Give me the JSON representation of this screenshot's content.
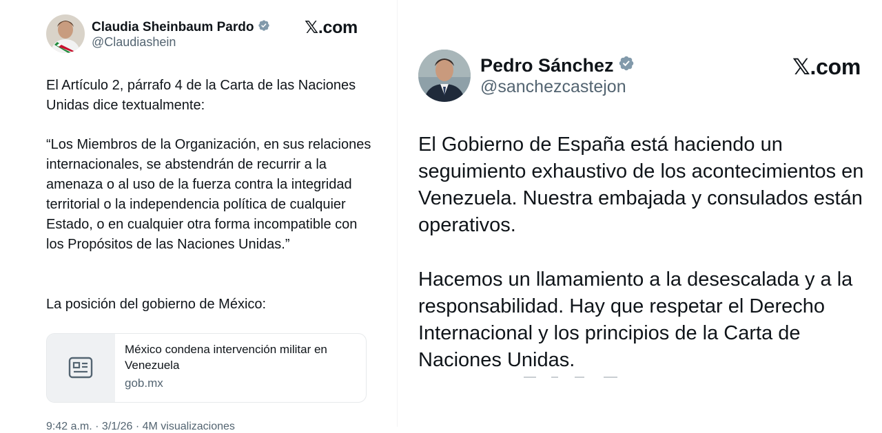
{
  "left_tweet": {
    "name": "Claudia Sheinbaum Pardo",
    "handle": "@Claudiashein",
    "brand": "𝕏.com",
    "paragraph_1": "El Artículo 2, párrafo 4 de la Carta de las Naciones Unidas dice textualmente:",
    "paragraph_2": "“Los Miembros de la Organización, en sus relaciones internacionales, se abstendrán de recurrir a la amenaza o al uso de la fuerza contra la integridad territorial o la independencia política de cualquier Estado, o en cualquier otra forma incompatible con los Propósitos de las Naciones Unidas.”",
    "paragraph_3": "La posición del gobierno de México:",
    "link_card": {
      "title": "México condena intervención militar en Venezuela",
      "domain": "gob.mx",
      "icon": "article-icon"
    },
    "meta": "9:42 a.m. · 3/1/26 · 4M visualizaciones"
  },
  "right_tweet": {
    "name": "Pedro Sánchez",
    "handle": "@sanchezcastejon",
    "brand": "𝕏.com",
    "paragraph_1": "El Gobierno de España está haciendo un seguimiento exhaustivo de los acontecimientos en Venezuela. Nuestra embajada y consulados están operativos.",
    "paragraph_2": "Hacemos un llamamiento a la desescalada y a la responsabilidad. Hay que respetar el Derecho Internacional y los principios de la Carta de Naciones Unidas."
  },
  "colors": {
    "text": "#0f1419",
    "secondary": "#536471",
    "verified_badge": "#829aab",
    "card_border": "#e6e9eb",
    "thumb_bg": "#eff1f3"
  }
}
